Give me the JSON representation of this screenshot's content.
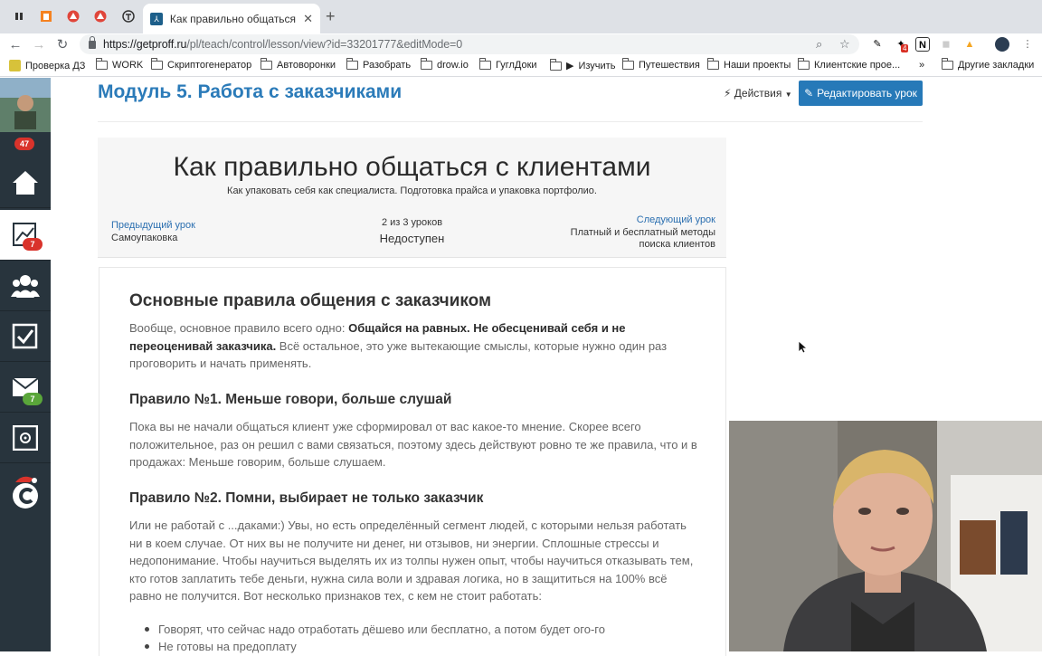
{
  "browser": {
    "tab_title": "Как правильно общаться с кл",
    "url_host": "https://getproff.ru",
    "url_path": "/pl/teach/control/lesson/view?id=33201777&editMode=0",
    "bookmarks": [
      "Проверка ДЗ",
      "WORK",
      "Скриптогенератор",
      "Автоворонки",
      "Разобрать",
      "drow.io",
      "ГуглДоки",
      "Изучить",
      "Путешествия",
      "Наши проекты",
      "Клиентские прое..."
    ],
    "other_bookmarks": "Другие закладки",
    "ext_badge": "4"
  },
  "sidebar": {
    "avatar_badge": "47",
    "stats_badge": "7",
    "mail_badge": "7"
  },
  "header": {
    "module_title": "Модуль 5. Работа с заказчиками",
    "actions_label": "Действия",
    "edit_label": "Редактировать урок"
  },
  "lesson": {
    "title": "Как правильно общаться с клиентами",
    "subtitle": "Как упаковать себя как специалиста. Подготовка прайса и упаковка портфолио.",
    "prev_label": "Предыдущий урок",
    "prev_name": "Самоупаковка",
    "counter": "2 из 3 уроков",
    "status": "Недоступен",
    "next_label": "Следующий урок",
    "next_name": "Платный и бесплатный методы поиска клиентов"
  },
  "body": {
    "heading": "Основные правила общения с заказчиком",
    "intro_plain": "Вообще, основное правило всего одно: ",
    "intro_bold": "Общайся на равных. Не обесценивай себя и не переоценивай заказчика.",
    "intro_rest": " Всё остальное, это уже вытекающие смыслы, которые нужно один раз проговорить и начать применять.",
    "rule1_title": "Правило №1. Меньше говори, больше слушай",
    "rule1_text": "Пока вы не начали общаться клиент уже сформировал от вас какое-то мнение. Скорее всего положительное, раз он решил с вами связаться, поэтому здесь действуют ровно те же правила, что и в продажах: Меньше говорим, больше слушаем.",
    "rule2_title": "Правило №2. Помни, выбирает не только заказчик",
    "rule2_text": "Или не работай с ...даками:) Увы, но есть определённый сегмент людей, с которыми нельзя работать ни в коем случае. От них вы не получите ни денег, ни отзывов, ни энергии. Сплошные стрессы и недопонимание. Чтобы научиться выделять их из толпы нужен опыт, чтобы научиться отказывать тем, кто готов заплатить тебе деньги, нужна сила воли и здравая логика, но в защититься на 100% всё равно не получится. Вот несколько признаков тех, с кем не стоит работать:",
    "bullets": [
      "Говорят, что сейчас надо отработать дёшево или бесплатно, а потом будет ого-го",
      "Не готовы на предоплату"
    ]
  }
}
